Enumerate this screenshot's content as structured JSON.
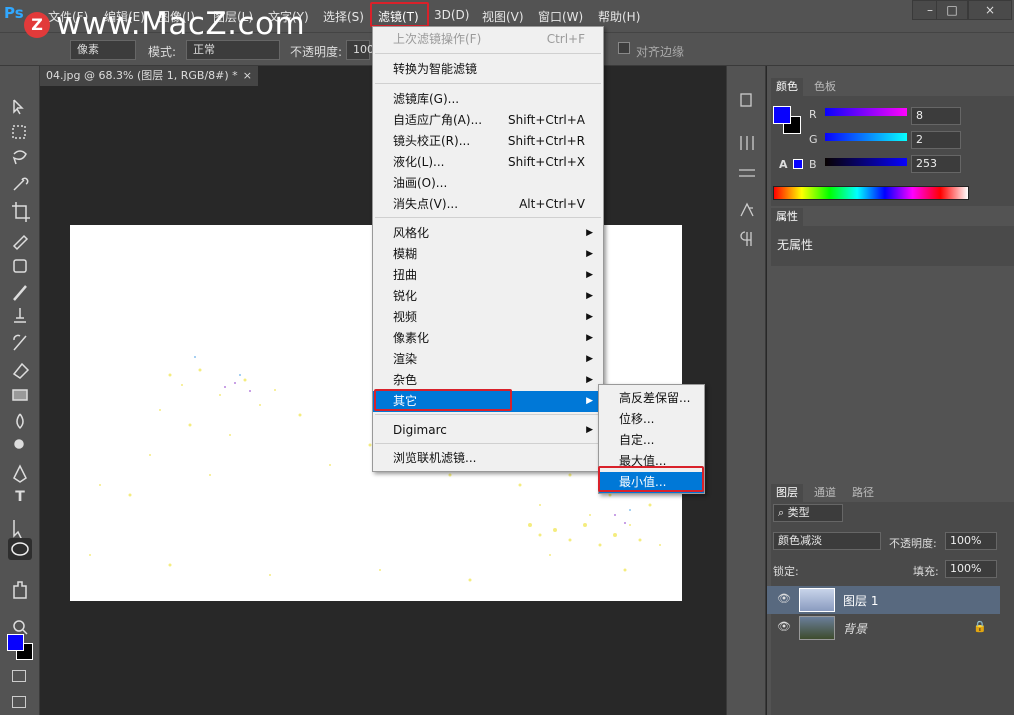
{
  "app": {
    "logo": "Ps"
  },
  "watermark": {
    "badge": "Z",
    "text": "www.MacZ.com"
  },
  "menubar": {
    "items": [
      "文件(F)",
      "编辑(E)",
      "图像(I)",
      "图层(L)",
      "文字(Y)",
      "选择(S)",
      "滤镜(T)",
      "3D(D)",
      "视图(V)",
      "窗口(W)",
      "帮助(H)"
    ],
    "active": "滤镜(T)"
  },
  "window_controls": {
    "minimize": "–",
    "maximize": "□",
    "close": "×"
  },
  "options_bar": {
    "unit": "像素",
    "mode_label": "模式:",
    "mode_value": "正常",
    "opacity_label": "不透明度:",
    "opacity_value": "100%",
    "anti_alias_label": "对齐边缘"
  },
  "document_tab": {
    "title": "04.jpg @ 68.3% (图层 1, RGB/8#) *",
    "close": "×"
  },
  "filter_menu": {
    "items": [
      {
        "label": "上次滤镜操作(F)",
        "shortcut": "Ctrl+F",
        "disabled": true
      },
      {
        "label": "转换为智能滤镜",
        "shortcut": ""
      },
      {
        "label": "滤镜库(G)...",
        "shortcut": ""
      },
      {
        "label": "自适应广角(A)...",
        "shortcut": "Shift+Ctrl+A"
      },
      {
        "label": "镜头校正(R)...",
        "shortcut": "Shift+Ctrl+R"
      },
      {
        "label": "液化(L)...",
        "shortcut": "Shift+Ctrl+X"
      },
      {
        "label": "油画(O)...",
        "shortcut": ""
      },
      {
        "label": "消失点(V)...",
        "shortcut": "Alt+Ctrl+V"
      },
      {
        "label": "风格化",
        "submenu": true
      },
      {
        "label": "模糊",
        "submenu": true
      },
      {
        "label": "扭曲",
        "submenu": true
      },
      {
        "label": "锐化",
        "submenu": true
      },
      {
        "label": "视频",
        "submenu": true
      },
      {
        "label": "像素化",
        "submenu": true
      },
      {
        "label": "渲染",
        "submenu": true
      },
      {
        "label": "杂色",
        "submenu": true
      },
      {
        "label": "其它",
        "submenu": true,
        "highlighted": true
      },
      {
        "label": "Digimarc",
        "submenu": true
      },
      {
        "label": "浏览联机滤镜...",
        "shortcut": ""
      }
    ]
  },
  "other_submenu": {
    "items": [
      "高反差保留...",
      "位移...",
      "自定...",
      "最大值...",
      "最小值..."
    ],
    "highlighted": "最小值..."
  },
  "color_panel": {
    "tabs": [
      "颜色",
      "色板"
    ],
    "r_label": "R",
    "r_value": "8",
    "g_label": "G",
    "g_value": "2",
    "b_label": "B",
    "b_value": "253",
    "foreground": "#0802fd",
    "background": "#000000"
  },
  "properties_panel": {
    "tab": "属性",
    "empty_text": "无属性"
  },
  "layers_panel": {
    "tabs": [
      "图层",
      "通道",
      "路径"
    ],
    "filter_label": "类型",
    "blend_mode": "颜色减淡",
    "opacity_label": "不透明度:",
    "opacity_value": "100%",
    "lock_label": "锁定:",
    "fill_label": "填充:",
    "fill_value": "100%",
    "layers": [
      {
        "name": "图层 1",
        "selected": true
      },
      {
        "name": "背景",
        "selected": false,
        "locked": true
      }
    ]
  },
  "toolbar": {
    "icons": [
      "move-icon",
      "marquee-icon",
      "lasso-icon",
      "quick-select-icon",
      "crop-icon",
      "eyedropper-icon",
      "healing-icon",
      "brush-icon",
      "stamp-icon",
      "history-brush-icon",
      "eraser-icon",
      "gradient-icon",
      "blur-icon",
      "dodge-icon",
      "pen-icon",
      "type-icon",
      "path-select-icon",
      "ellipse-icon",
      "hand-icon",
      "zoom-icon"
    ],
    "type_glyph": "T"
  }
}
